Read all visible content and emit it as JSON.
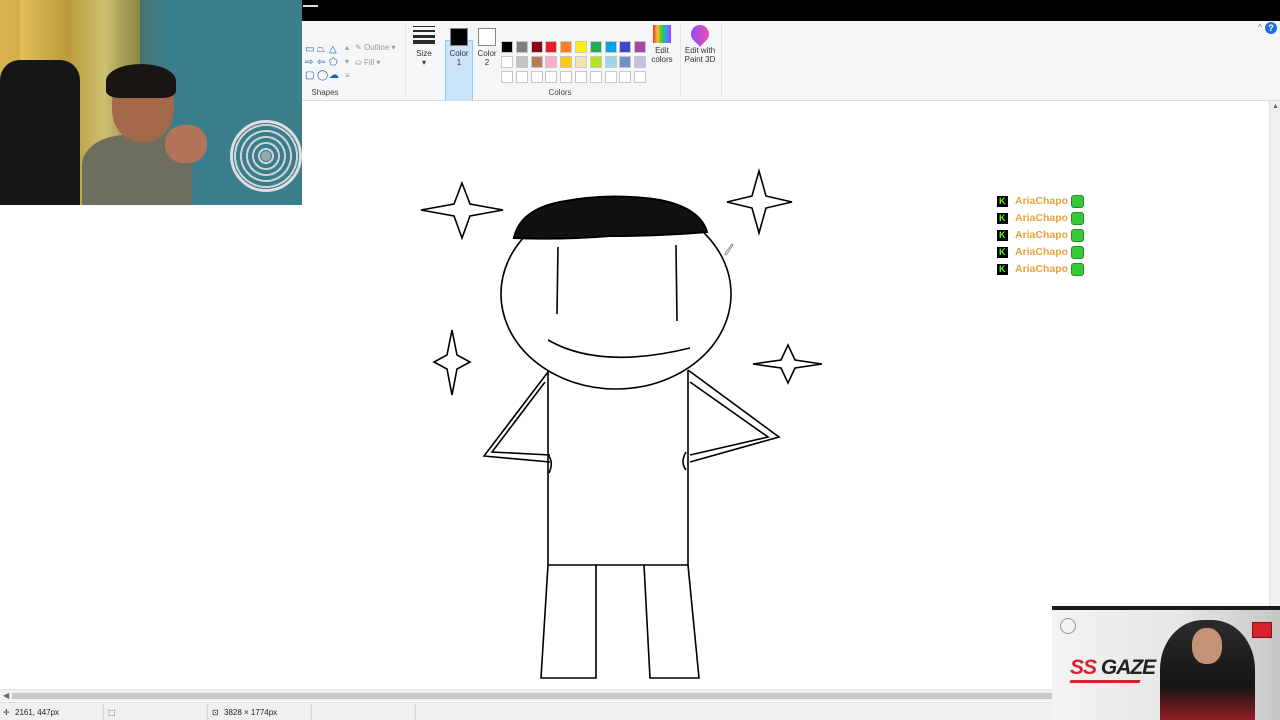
{
  "app": {
    "ribbon": {
      "shapes_group": {
        "label": "Shapes",
        "outline_label": "Outline",
        "fill_label": "Fill"
      },
      "size": {
        "label": "Size"
      },
      "color1": {
        "label_1": "Color",
        "label_2": "1",
        "value": "#000000"
      },
      "color2": {
        "label_1": "Color",
        "label_2": "2",
        "value": "#ffffff"
      },
      "colors_group": {
        "label": "Colors"
      },
      "edit_colors": {
        "label_1": "Edit",
        "label_2": "colors"
      },
      "paint3d": {
        "label_1": "Edit with",
        "label_2": "Paint 3D"
      },
      "help": "?",
      "minimize_ribbon": "^"
    },
    "palette": [
      "#000000",
      "#7f7f7f",
      "#880015",
      "#ed1c24",
      "#ff7f27",
      "#fff200",
      "#22b14c",
      "#00a2e8",
      "#3f48cc",
      "#a349a4",
      "#ffffff",
      "#c3c3c3",
      "#b97a57",
      "#ffaec9",
      "#ffc90e",
      "#efe4b0",
      "#b5e61d",
      "#99d9ea",
      "#7092be",
      "#c8bfe7",
      "#ffffff",
      "#ffffff",
      "#ffffff",
      "#ffffff",
      "#ffffff",
      "#ffffff",
      "#ffffff",
      "#ffffff",
      "#ffffff",
      "#ffffff"
    ],
    "status": {
      "cursor_pos": "2161, 447px",
      "image_size": "3828 × 1774px"
    }
  },
  "overlay": {
    "chat": [
      {
        "user": "AriaChapo"
      },
      {
        "user": "AriaChapo"
      },
      {
        "user": "AriaChapo"
      },
      {
        "user": "AriaChapo"
      },
      {
        "user": "AriaChapo"
      }
    ],
    "sponsor": {
      "brand_1": "SS",
      "brand_2": "GAZE"
    }
  },
  "icons": {
    "webcam": "webcam-feed",
    "chat_platform": "kick-icon",
    "chat_emote": "emote-icon",
    "scroll_up": "chevron-up-icon",
    "scroll_left": "chevron-left-icon",
    "cursor_pos": "cursor-position-icon",
    "selection_size": "selection-size-icon"
  }
}
